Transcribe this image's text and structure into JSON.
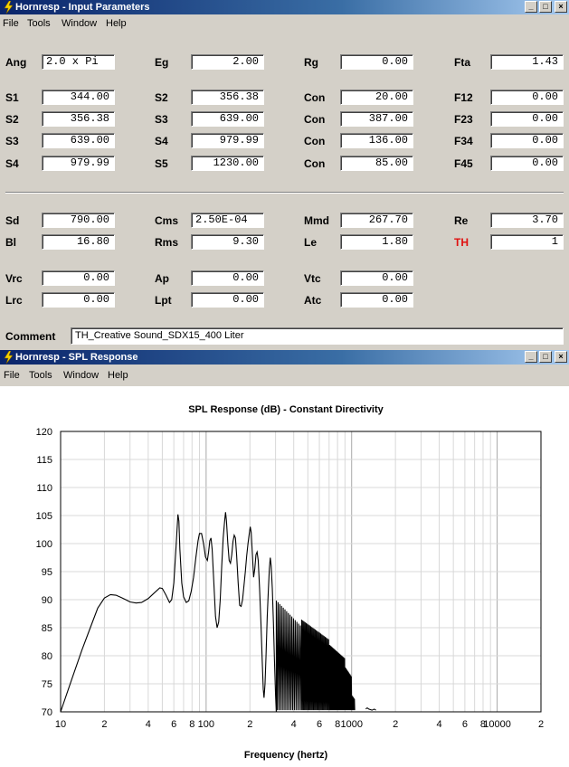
{
  "window1": {
    "title": "Hornresp - Input Parameters",
    "menu": [
      "File",
      "Tools",
      "Window",
      "Help"
    ],
    "rows": [
      [
        {
          "l": "Ang",
          "v": "2.0 x Pi",
          "left": true
        },
        {
          "l": "Eg",
          "v": "2.00"
        },
        {
          "l": "Rg",
          "v": "0.00"
        },
        {
          "l": "Fta",
          "v": "1.43"
        }
      ],
      [
        {
          "l": "S1",
          "v": "344.00"
        },
        {
          "l": "S2",
          "v": "356.38"
        },
        {
          "l": "Con",
          "v": "20.00"
        },
        {
          "l": "F12",
          "v": "0.00"
        }
      ],
      [
        {
          "l": "S2",
          "v": "356.38"
        },
        {
          "l": "S3",
          "v": "639.00"
        },
        {
          "l": "Con",
          "v": "387.00"
        },
        {
          "l": "F23",
          "v": "0.00"
        }
      ],
      [
        {
          "l": "S3",
          "v": "639.00"
        },
        {
          "l": "S4",
          "v": "979.99"
        },
        {
          "l": "Con",
          "v": "136.00"
        },
        {
          "l": "F34",
          "v": "0.00"
        }
      ],
      [
        {
          "l": "S4",
          "v": "979.99"
        },
        {
          "l": "S5",
          "v": "1230.00"
        },
        {
          "l": "Con",
          "v": "85.00"
        },
        {
          "l": "F45",
          "v": "0.00"
        }
      ],
      [
        {
          "l": "Sd",
          "v": "790.00"
        },
        {
          "l": "Cms",
          "v": "2.50E-04",
          "left": true
        },
        {
          "l": "Mmd",
          "v": "267.70"
        },
        {
          "l": "Re",
          "v": "3.70"
        }
      ],
      [
        {
          "l": "Bl",
          "v": "16.80"
        },
        {
          "l": "Rms",
          "v": "9.30"
        },
        {
          "l": "Le",
          "v": "1.80"
        },
        {
          "l": "TH",
          "v": "1",
          "red": true
        }
      ],
      [
        {
          "l": "Vrc",
          "v": "0.00"
        },
        {
          "l": "Ap",
          "v": "0.00"
        },
        {
          "l": "Vtc",
          "v": "0.00"
        }
      ],
      [
        {
          "l": "Lrc",
          "v": "0.00"
        },
        {
          "l": "Lpt",
          "v": "0.00"
        },
        {
          "l": "Atc",
          "v": "0.00"
        }
      ]
    ],
    "comment_label": "Comment",
    "comment_value": "TH_Creative Sound_SDX15_400 Liter"
  },
  "window2": {
    "title": "Hornresp - SPL Response",
    "menu": [
      "File",
      "Tools",
      "Window",
      "Help"
    ]
  },
  "chart_data": {
    "type": "line",
    "title": "SPL Response (dB) - Constant Directivity",
    "xlabel": "Frequency (hertz)",
    "ylabel": "",
    "xscale": "log",
    "xlim": [
      10,
      20000
    ],
    "ylim": [
      70,
      120
    ],
    "yticks": [
      70,
      75,
      80,
      85,
      90,
      95,
      100,
      105,
      110,
      115,
      120
    ],
    "xtick_labels": [
      {
        "f": 10,
        "t": "10"
      },
      {
        "f": 20,
        "t": "2"
      },
      {
        "f": 40,
        "t": "4"
      },
      {
        "f": 60,
        "t": "6"
      },
      {
        "f": 80,
        "t": "8"
      },
      {
        "f": 100,
        "t": "100"
      },
      {
        "f": 200,
        "t": "2"
      },
      {
        "f": 400,
        "t": "4"
      },
      {
        "f": 600,
        "t": "6"
      },
      {
        "f": 800,
        "t": "8"
      },
      {
        "f": 1000,
        "t": "1000"
      },
      {
        "f": 2000,
        "t": "2"
      },
      {
        "f": 4000,
        "t": "4"
      },
      {
        "f": 6000,
        "t": "6"
      },
      {
        "f": 8000,
        "t": "8"
      },
      {
        "f": 10000,
        "t": "10000"
      },
      {
        "f": 20000,
        "t": "2"
      }
    ],
    "grid": true,
    "series": [
      {
        "color": "#000000",
        "points": [
          [
            10,
            70
          ],
          [
            12,
            76
          ],
          [
            14,
            81
          ],
          [
            16,
            85
          ],
          [
            18,
            88.5
          ],
          [
            20,
            90.3
          ],
          [
            22,
            90.9
          ],
          [
            24,
            90.8
          ],
          [
            26,
            90.4
          ],
          [
            28,
            90
          ],
          [
            30,
            89.6
          ],
          [
            33,
            89.4
          ],
          [
            36,
            89.5
          ],
          [
            40,
            90.2
          ],
          [
            44,
            91.2
          ],
          [
            48,
            92.1
          ],
          [
            50,
            92
          ],
          [
            53,
            90.8
          ],
          [
            56,
            89.5
          ],
          [
            58,
            90
          ],
          [
            60,
            93
          ],
          [
            62,
            99
          ],
          [
            64,
            105.2
          ],
          [
            65,
            104
          ],
          [
            66,
            99
          ],
          [
            68,
            93
          ],
          [
            70,
            90.5
          ],
          [
            73,
            89.5
          ],
          [
            76,
            89.8
          ],
          [
            79,
            91.5
          ],
          [
            82,
            94
          ],
          [
            85,
            97.5
          ],
          [
            88,
            100.5
          ],
          [
            90,
            101.8
          ],
          [
            93,
            101.8
          ],
          [
            96,
            100
          ],
          [
            99,
            97.6
          ],
          [
            102,
            97
          ],
          [
            104,
            98.5
          ],
          [
            106,
            100.5
          ],
          [
            108,
            101
          ],
          [
            110,
            99
          ],
          [
            113,
            93
          ],
          [
            116,
            87
          ],
          [
            119,
            85
          ],
          [
            122,
            86
          ],
          [
            125,
            90
          ],
          [
            128,
            96
          ],
          [
            131,
            101
          ],
          [
            134,
            104
          ],
          [
            136,
            105.6
          ],
          [
            138,
            104
          ],
          [
            141,
            100
          ],
          [
            144,
            97
          ],
          [
            147,
            96.5
          ],
          [
            150,
            98
          ],
          [
            153,
            100.4
          ],
          [
            156,
            101.5
          ],
          [
            159,
            101
          ],
          [
            162,
            98
          ],
          [
            166,
            93
          ],
          [
            170,
            89
          ],
          [
            174,
            88.8
          ],
          [
            178,
            90
          ],
          [
            182,
            92.5
          ],
          [
            186,
            95
          ],
          [
            190,
            97.8
          ],
          [
            194,
            100
          ],
          [
            198,
            101.8
          ],
          [
            201,
            103
          ],
          [
            204,
            102
          ],
          [
            208,
            98
          ],
          [
            212,
            94
          ],
          [
            216,
            95.5
          ],
          [
            220,
            98
          ],
          [
            224,
            98.5
          ],
          [
            228,
            97
          ],
          [
            233,
            92
          ],
          [
            238,
            86
          ],
          [
            243,
            79
          ],
          [
            247,
            74
          ],
          [
            250,
            72.5
          ],
          [
            254,
            75
          ],
          [
            258,
            80
          ],
          [
            263,
            87
          ],
          [
            268,
            92
          ],
          [
            272,
            95.5
          ],
          [
            276,
            97.5
          ],
          [
            280,
            96
          ],
          [
            285,
            92
          ],
          [
            290,
            86
          ],
          [
            295,
            79
          ],
          [
            300,
            73
          ],
          [
            304,
            70
          ]
        ]
      }
    ],
    "sections": [
      {
        "from": 300,
        "to": 450,
        "min": 71,
        "max": 90
      },
      {
        "from": 450,
        "to": 700,
        "min": 72,
        "max": 86.5
      },
      {
        "from": 700,
        "to": 900,
        "min": 72,
        "max": 82
      },
      {
        "from": 900,
        "to": 1000,
        "min": 71,
        "max": 78
      },
      {
        "from": 1000,
        "to": 1050,
        "min": 70,
        "max": 73
      }
    ],
    "tail": [
      [
        1250,
        70.5
      ],
      [
        1280,
        70.7
      ],
      [
        1310,
        70.5
      ],
      [
        1380,
        70.3
      ],
      [
        1430,
        70.5
      ],
      [
        1470,
        70.3
      ]
    ]
  }
}
